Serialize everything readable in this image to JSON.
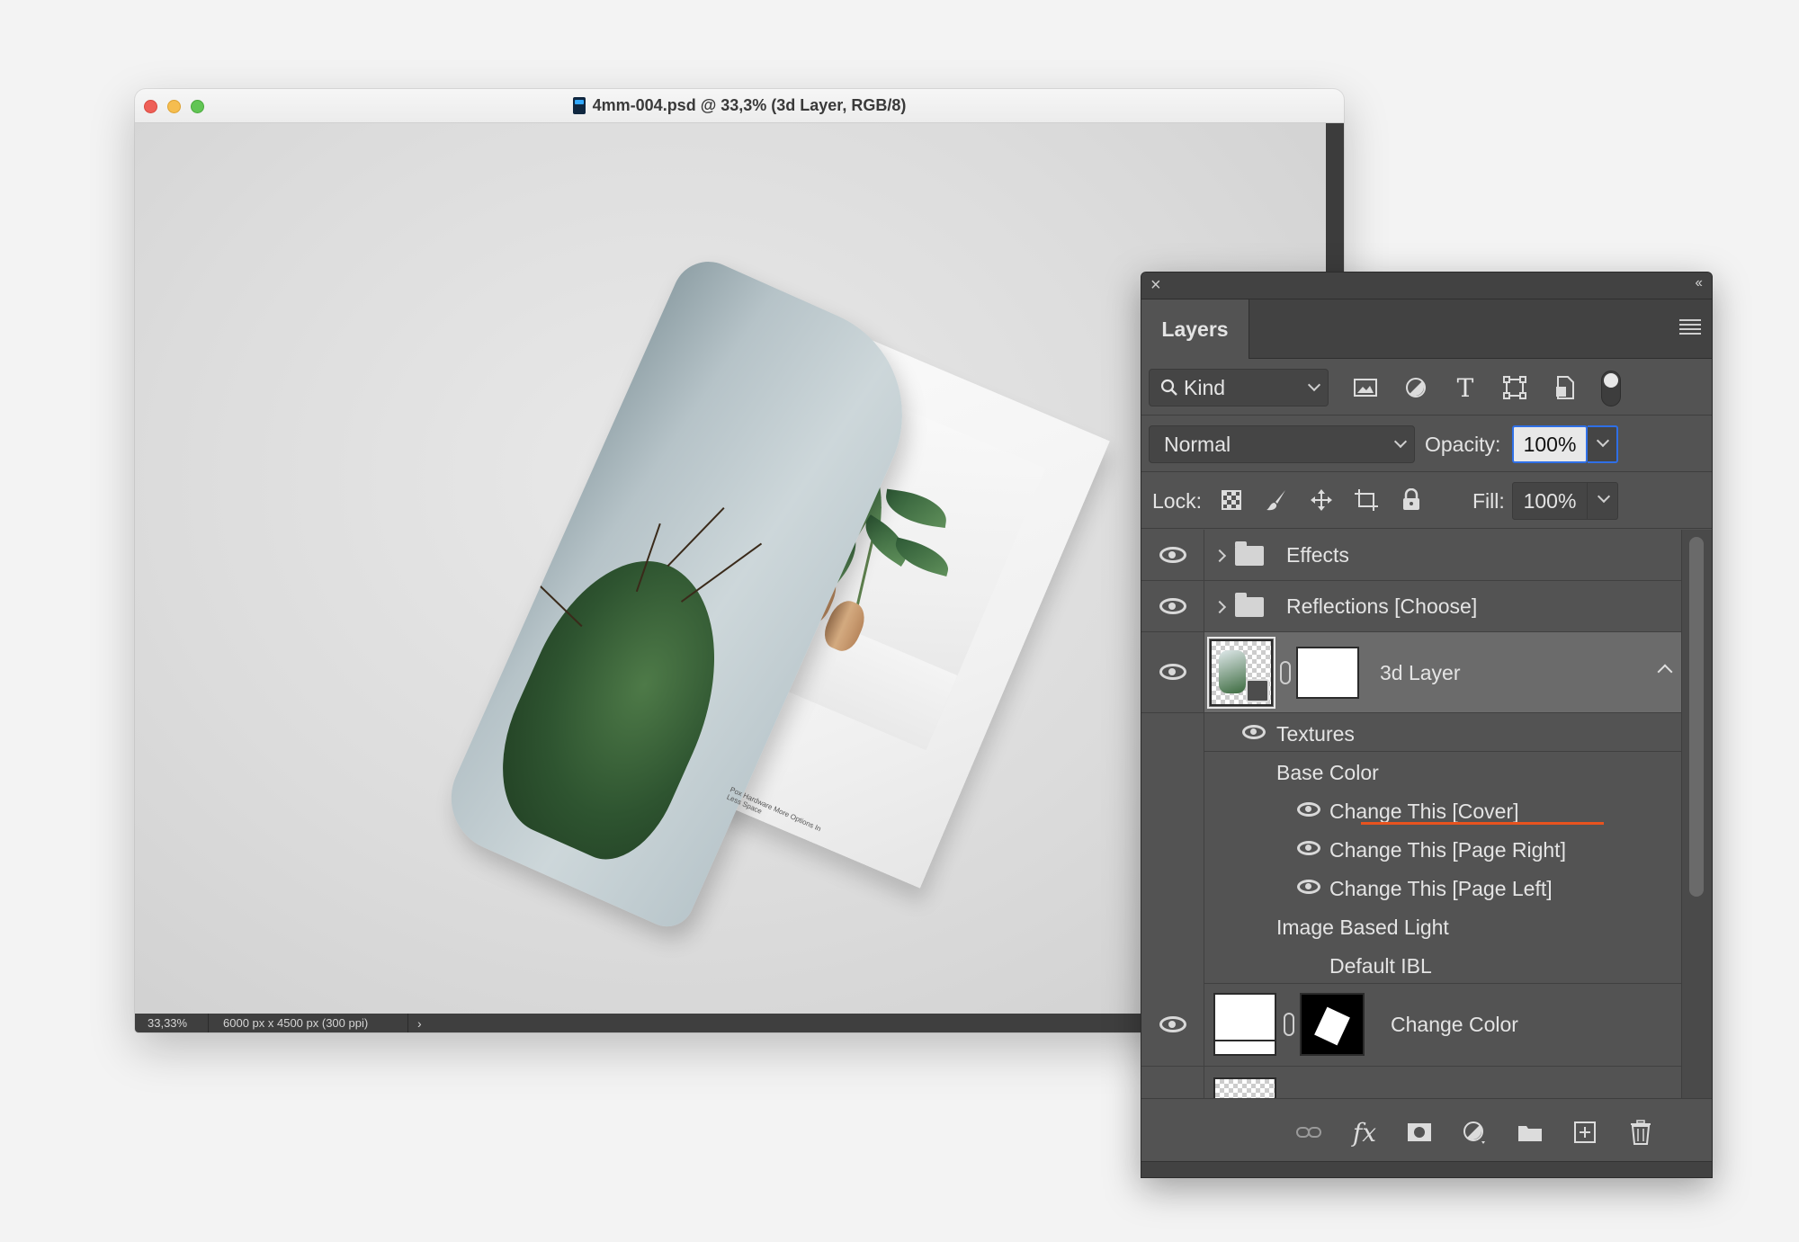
{
  "document": {
    "title": "4mm-004.psd @ 33,3% (3d Layer, RGB/8)",
    "status_zoom": "33,33%",
    "status_info": "6000 px x 4500 px (300 ppi)",
    "status_arrow": "›",
    "page_caption": "Pox Hardware More Options In Less Space"
  },
  "layers_panel": {
    "close_glyph": "×",
    "collapse_glyph": "‹‹",
    "tab_label": "Layers",
    "filter": {
      "kind_label": "Kind",
      "icons": [
        "image-filter-icon",
        "adjustment-filter-icon",
        "type-filter-icon",
        "shape-filter-icon",
        "smart-object-filter-icon"
      ],
      "type_glyph": "T"
    },
    "blend": {
      "mode": "Normal",
      "opacity_label": "Opacity:",
      "opacity_value": "100%"
    },
    "lock": {
      "label": "Lock:",
      "fill_label": "Fill:",
      "fill_value": "100%"
    },
    "layers": {
      "effects": "Effects",
      "reflections": "Reflections [Choose]",
      "three_d": "3d Layer",
      "textures": "Textures",
      "base_color": "Base Color",
      "cover": "Change This [Cover]",
      "page_right": "Change This [Page Right]",
      "page_left": "Change This [Page Left]",
      "ibl": "Image Based Light",
      "default_ibl": "Default IBL",
      "change_color": "Change Color"
    },
    "footer": {
      "fx_label": "fx"
    }
  },
  "colors": {
    "panel_bg": "#535353",
    "selected_row": "#6b6b6b",
    "accent_blue": "#2f6fe6",
    "underline_orange": "#e8531f"
  }
}
